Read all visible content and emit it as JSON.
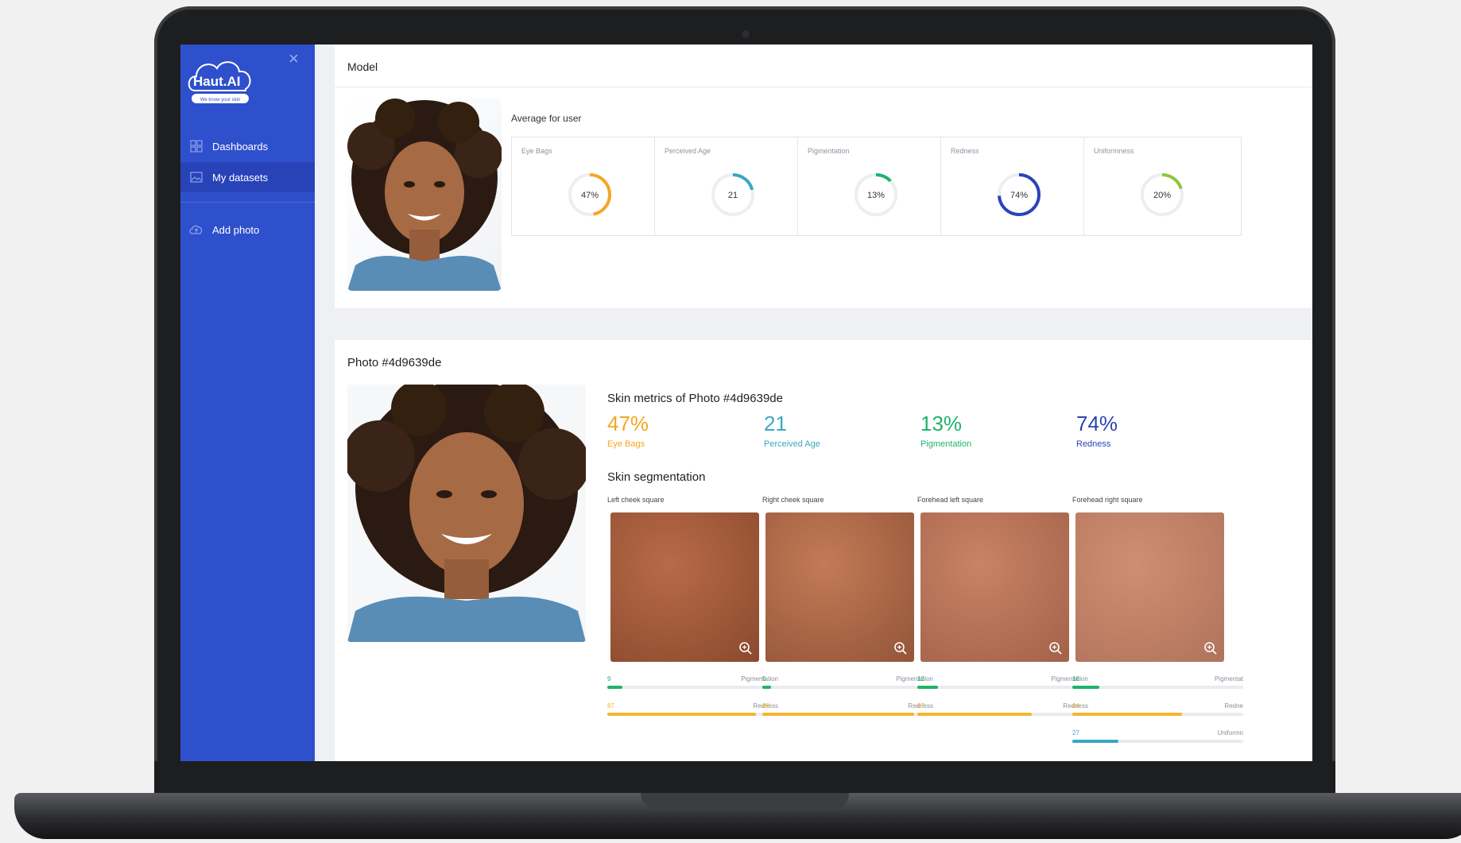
{
  "sidebar": {
    "logo_text": "Haut.AI",
    "logo_tagline": "We know your skin",
    "items": [
      {
        "label": "Dashboards",
        "icon": "grid-icon"
      },
      {
        "label": "My datasets",
        "icon": "image-icon"
      },
      {
        "label": "Add photo",
        "icon": "cloud-upload-icon"
      }
    ]
  },
  "model": {
    "title": "Model",
    "average_label": "Average for user",
    "metrics": [
      {
        "label": "Eye Bags",
        "value": 0.47,
        "display": "47%",
        "color": "#f5a623"
      },
      {
        "label": "Perceived Age",
        "value": 0.21,
        "display": "21",
        "color": "#3aa7c4"
      },
      {
        "label": "Pigmentation",
        "value": 0.13,
        "display": "13%",
        "color": "#1fb36b"
      },
      {
        "label": "Redness",
        "value": 0.74,
        "display": "74%",
        "color": "#2a44b6"
      },
      {
        "label": "Uniformness",
        "value": 0.2,
        "display": "20%",
        "color": "#8cc63f"
      }
    ]
  },
  "photo": {
    "title": "Photo #4d9639de",
    "metrics_title": "Skin metrics of Photo #4d9639de",
    "big_metrics": [
      {
        "value": "47%",
        "label": "Eye Bags",
        "color": "#f5a623"
      },
      {
        "value": "21",
        "label": "Perceived Age",
        "color": "#3aa7c4"
      },
      {
        "value": "13%",
        "label": "Pigmentation",
        "color": "#1fb36b"
      },
      {
        "value": "74%",
        "label": "Redness",
        "color": "#2a44b6"
      }
    ],
    "segmentation_title": "Skin segmentation",
    "segments": [
      {
        "caption": "Left cheek square",
        "bars": [
          {
            "num": "9",
            "name": "Pigmentation",
            "pct": 0.09,
            "color": "#1fb36b"
          },
          {
            "num": "87",
            "name": "Redness",
            "pct": 0.87,
            "color": "#f5b52c"
          }
        ]
      },
      {
        "caption": "Right cheek square",
        "bars": [
          {
            "num": "5",
            "name": "Pigmentation",
            "pct": 0.05,
            "color": "#1fb36b"
          },
          {
            "num": "89",
            "name": "Redness",
            "pct": 0.89,
            "color": "#f5b52c"
          }
        ]
      },
      {
        "caption": "Forehead left square",
        "bars": [
          {
            "num": "12",
            "name": "Pigmentation",
            "pct": 0.12,
            "color": "#1fb36b"
          },
          {
            "num": "67",
            "name": "Redness",
            "pct": 0.67,
            "color": "#f5b52c"
          }
        ]
      },
      {
        "caption": "Forehead right square",
        "bars": [
          {
            "num": "16",
            "name": "Pigmentat",
            "pct": 0.16,
            "color": "#1fb36b"
          },
          {
            "num": "64",
            "name": "Redne",
            "pct": 0.64,
            "color": "#f5b52c"
          },
          {
            "num": "27",
            "name": "Uniformn",
            "pct": 0.27,
            "color": "#3aa7c4"
          }
        ]
      }
    ]
  }
}
